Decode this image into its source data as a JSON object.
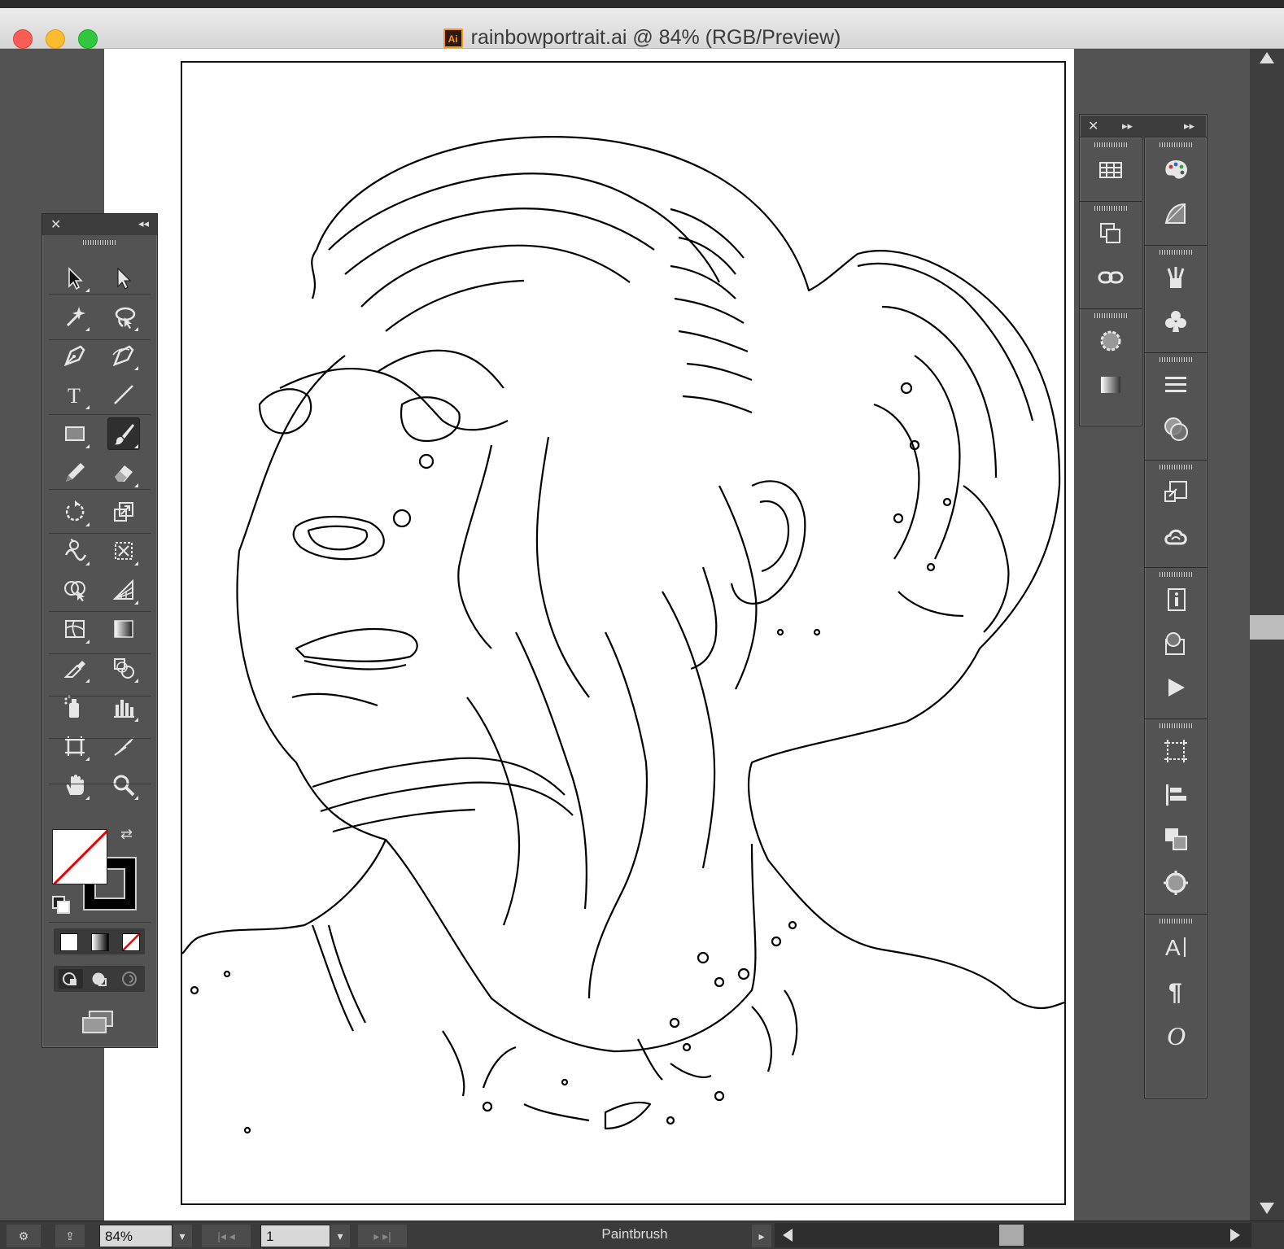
{
  "window": {
    "title": "rainbowportrait.ai @ 84% (RGB/Preview)",
    "app_badge": "Ai",
    "traffic_lights": {
      "close": "#fc5d54",
      "minimize": "#fdbb2e",
      "zoom": "#30c73f"
    }
  },
  "tools_panel": {
    "collapse_glyph": "◂◂",
    "close_glyph": "✕",
    "tools": [
      {
        "name": "selection-tool",
        "icon": "arrow-black"
      },
      {
        "name": "direct-selection-tool",
        "icon": "arrow-white"
      },
      {
        "name": "magic-wand-tool",
        "icon": "magic-wand"
      },
      {
        "name": "lasso-tool",
        "icon": "lasso"
      },
      {
        "name": "pen-tool",
        "icon": "pen"
      },
      {
        "name": "curvature-tool",
        "icon": "pen-curve"
      },
      {
        "name": "type-tool",
        "icon": "type"
      },
      {
        "name": "line-segment-tool",
        "icon": "line"
      },
      {
        "name": "rectangle-tool",
        "icon": "rectangle"
      },
      {
        "name": "paintbrush-tool",
        "icon": "paintbrush",
        "selected": true
      },
      {
        "name": "pencil-tool",
        "icon": "pencil"
      },
      {
        "name": "eraser-tool",
        "icon": "eraser"
      },
      {
        "name": "rotate-tool",
        "icon": "rotate"
      },
      {
        "name": "scale-tool",
        "icon": "scale"
      },
      {
        "name": "warp-tool",
        "icon": "warp"
      },
      {
        "name": "free-transform-tool",
        "icon": "free-transform"
      },
      {
        "name": "shape-builder-tool",
        "icon": "shape-builder"
      },
      {
        "name": "perspective-grid-tool",
        "icon": "perspective-grid"
      },
      {
        "name": "mesh-tool",
        "icon": "mesh"
      },
      {
        "name": "gradient-tool",
        "icon": "gradient"
      },
      {
        "name": "eyedropper-tool",
        "icon": "eyedropper"
      },
      {
        "name": "blend-tool",
        "icon": "blend"
      },
      {
        "name": "symbol-sprayer-tool",
        "icon": "symbol-sprayer"
      },
      {
        "name": "column-graph-tool",
        "icon": "column-graph"
      },
      {
        "name": "artboard-tool",
        "icon": "artboard"
      },
      {
        "name": "slice-tool",
        "icon": "slice"
      },
      {
        "name": "hand-tool",
        "icon": "hand"
      },
      {
        "name": "zoom-tool",
        "icon": "zoom"
      }
    ],
    "fill": "none",
    "stroke": "#000000",
    "color_modes": [
      "color",
      "gradient",
      "none"
    ],
    "draw_modes": [
      "draw-normal",
      "draw-behind",
      "draw-inside"
    ],
    "screen_mode": "change-screen-mode"
  },
  "docked_panels": {
    "left_column": [
      "swatches-grid-icon",
      "transform-icon",
      "links-icon",
      "appearance-icon",
      "gradient-panel-icon"
    ],
    "right_column": [
      "color-palette-icon",
      "color-guide-icon",
      "brushes-icon",
      "symbols-icon",
      "stroke-icon",
      "transparency-icon",
      "asset-export-icon",
      "cc-libraries-icon",
      "document-info-icon",
      "graphic-styles-icon",
      "actions-icon",
      "transform-panel-icon",
      "align-icon",
      "pathfinder-icon",
      "navigator-icon",
      "character-icon",
      "paragraph-icon",
      "opentype-icon"
    ],
    "expand_glyph": "▸▸"
  },
  "status": {
    "zoom": "84%",
    "artboard_number": "1",
    "current_tool": "Paintbrush"
  }
}
